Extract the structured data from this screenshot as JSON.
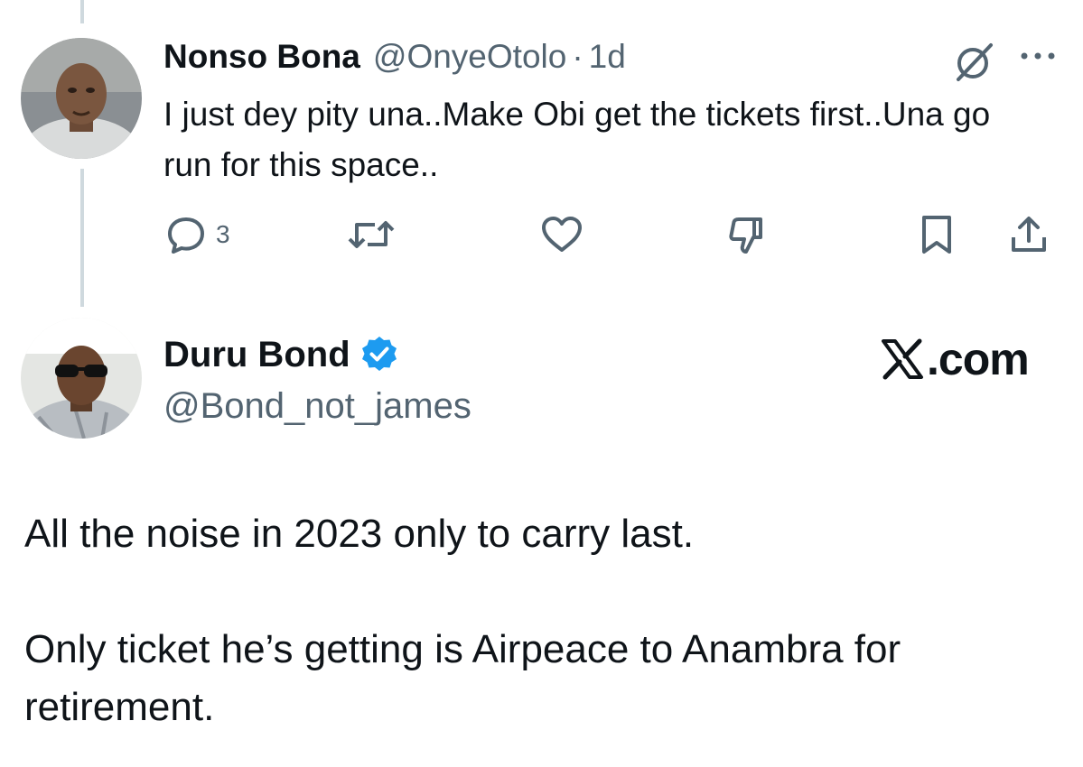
{
  "reply_tweet": {
    "author_name": "Nonso Bona",
    "author_handle": "@OnyeOtolo",
    "separator": "·",
    "time": "1d",
    "text": "I just dey pity una..Make Obi get the tickets first..Una go run for this space..",
    "actions": {
      "reply_count": "3"
    },
    "icons": [
      "grok-icon",
      "more-icon",
      "reply-icon",
      "retweet-icon",
      "like-icon",
      "dislike-icon",
      "bookmark-icon",
      "share-icon"
    ]
  },
  "main_tweet": {
    "author_name": "Duru Bond",
    "verified": true,
    "author_handle": "@Bond_not_james",
    "text_paragraphs": [
      "All the noise in 2023 only to carry last.",
      "Only ticket he’s getting is Airpeace to Anambra for retirement."
    ]
  },
  "watermark": {
    "logo": "x-logo-icon",
    "text": ".com"
  },
  "colors": {
    "text_primary": "#0f1419",
    "text_secondary": "#536471",
    "verified_blue": "#1d9bf0",
    "thread_line": "#cfd9de"
  }
}
